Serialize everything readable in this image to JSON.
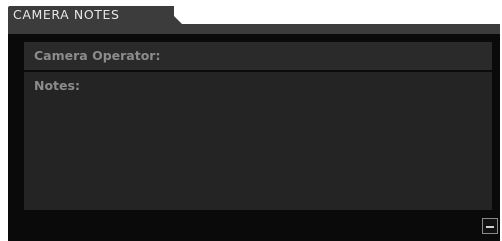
{
  "panel": {
    "tab_title": "CAMERA NOTES",
    "camera_operator_label": "Camera Operator:",
    "notes_label": "Notes:",
    "collapse_icon": "minus-icon"
  },
  "colors": {
    "tab": "#3c3c3c",
    "background": "#0a0a0a",
    "field": "#2a2a2a",
    "label": "#8c8c8c"
  }
}
